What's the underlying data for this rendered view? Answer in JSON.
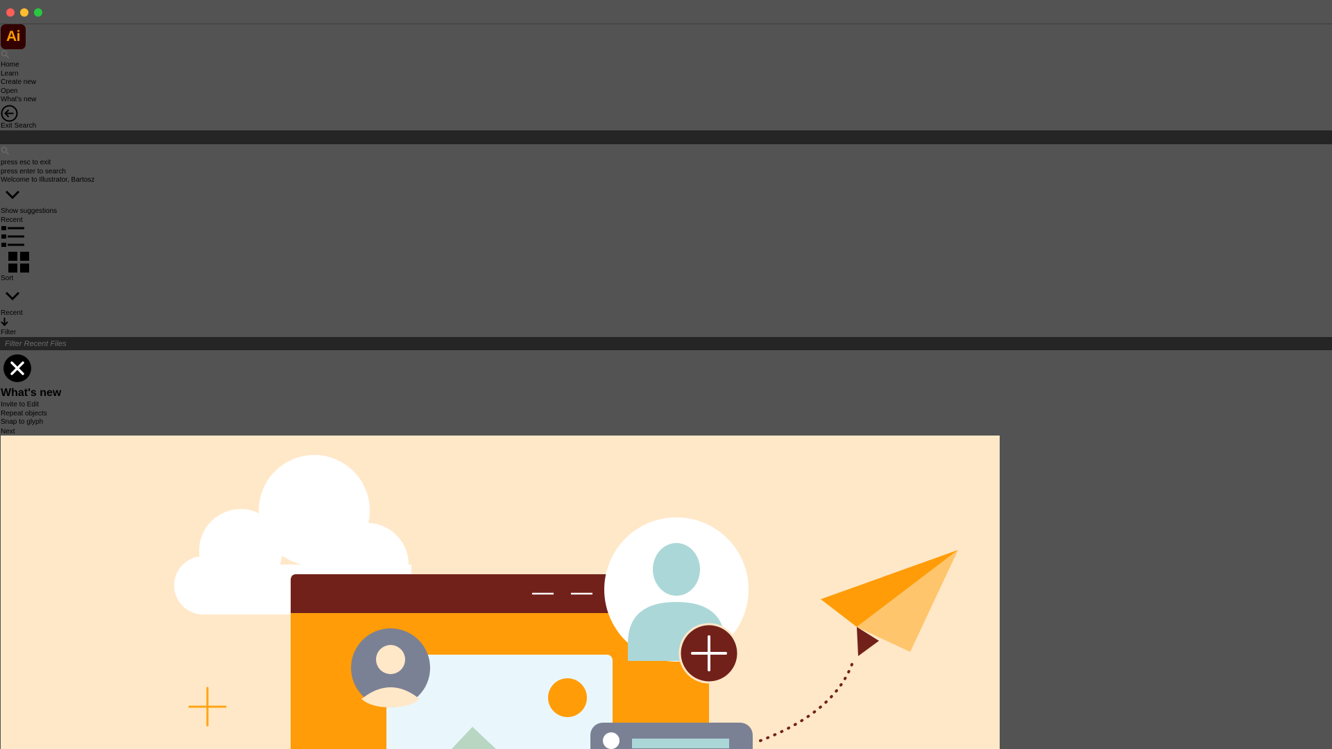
{
  "window": {
    "traffic_lights": [
      "close",
      "minimize",
      "maximize"
    ]
  },
  "app": {
    "logo_text": "Ai",
    "logo_bg": "#330000",
    "logo_fg": "#ff9a00"
  },
  "nav": {
    "items": [
      {
        "label": "Home"
      },
      {
        "label": "Learn"
      },
      {
        "label": "Create new"
      },
      {
        "label": "Open"
      },
      {
        "label": "What's new"
      }
    ],
    "exit_search": "Exit Search"
  },
  "search": {
    "hint_exit": "press esc to exit",
    "hint_enter": "press enter to search",
    "welcome": "Welcome to Illustrator, Bartosz",
    "show_suggestions": "Show suggestions"
  },
  "recent": {
    "heading": "Recent",
    "sort_label": "Sort",
    "sort_value": "Recent",
    "filter_label": "Filter",
    "filter_placeholder": "Filter Recent Files"
  },
  "whats_new": {
    "title": "What's new",
    "items": [
      {
        "label": "Invite to Edit"
      },
      {
        "label": "Repeat objects"
      },
      {
        "label": "Snap to glyph"
      }
    ],
    "next_label": "Next"
  },
  "colors": {
    "background": "#535353",
    "bar": "#252525",
    "illustration_bg": "#ffe8c8",
    "accent_orange": "#ff9a00",
    "dark_red": "#72211a"
  }
}
